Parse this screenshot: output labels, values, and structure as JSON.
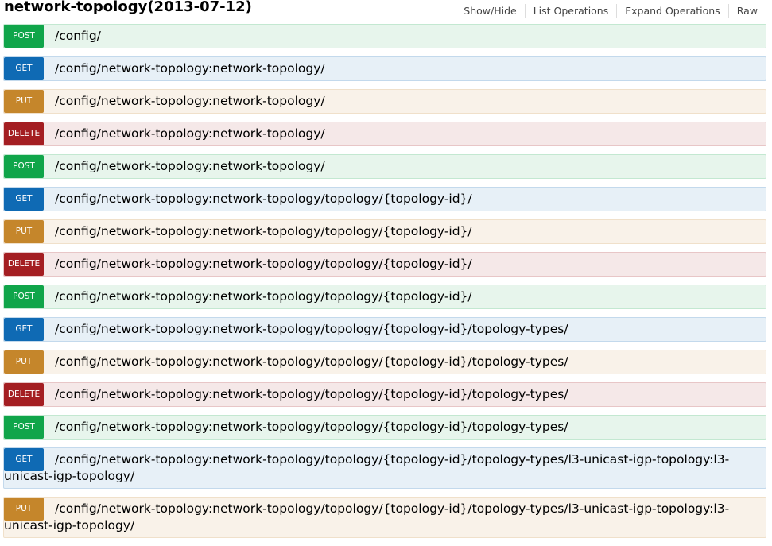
{
  "header": {
    "title": "network-topology(2013-07-12)",
    "actions": [
      "Show/Hide",
      "List Operations",
      "Expand Operations",
      "Raw"
    ]
  },
  "operations": [
    {
      "method": "POST",
      "path": "/config/"
    },
    {
      "method": "GET",
      "path": "/config/network-topology:network-topology/"
    },
    {
      "method": "PUT",
      "path": "/config/network-topology:network-topology/"
    },
    {
      "method": "DELETE",
      "path": "/config/network-topology:network-topology/"
    },
    {
      "method": "POST",
      "path": "/config/network-topology:network-topology/"
    },
    {
      "method": "GET",
      "path": "/config/network-topology:network-topology/topology/{topology-id}/"
    },
    {
      "method": "PUT",
      "path": "/config/network-topology:network-topology/topology/{topology-id}/"
    },
    {
      "method": "DELETE",
      "path": "/config/network-topology:network-topology/topology/{topology-id}/"
    },
    {
      "method": "POST",
      "path": "/config/network-topology:network-topology/topology/{topology-id}/"
    },
    {
      "method": "GET",
      "path": "/config/network-topology:network-topology/topology/{topology-id}/topology-types/"
    },
    {
      "method": "PUT",
      "path": "/config/network-topology:network-topology/topology/{topology-id}/topology-types/"
    },
    {
      "method": "DELETE",
      "path": "/config/network-topology:network-topology/topology/{topology-id}/topology-types/"
    },
    {
      "method": "POST",
      "path": "/config/network-topology:network-topology/topology/{topology-id}/topology-types/"
    },
    {
      "method": "GET",
      "path": "/config/network-topology:network-topology/topology/{topology-id}/topology-types/l3-unicast-igp-topology:l3-unicast-igp-topology/"
    },
    {
      "method": "PUT",
      "path": "/config/network-topology:network-topology/topology/{topology-id}/topology-types/l3-unicast-igp-topology:l3-unicast-igp-topology/"
    }
  ]
}
